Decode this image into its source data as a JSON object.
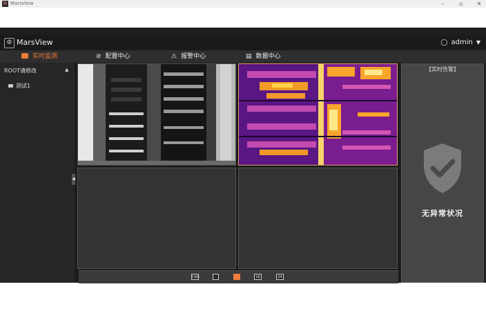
{
  "window": {
    "title": "MarsView",
    "logo_letter": "N",
    "controls": {
      "minimize": "–",
      "maximize": "▫",
      "close": "✕"
    }
  },
  "header": {
    "brand": "MarsView",
    "user": "admin",
    "icons": {
      "brand": "gear-icon",
      "user": "person-icon",
      "caret": "caret-down-icon"
    }
  },
  "nav": {
    "tabs": [
      {
        "label": "实时监测",
        "icon": "monitor-icon",
        "active": true
      },
      {
        "label": "配置中心",
        "icon": "settings-icon",
        "active": false
      },
      {
        "label": "报警中心",
        "icon": "alarm-icon",
        "active": false
      },
      {
        "label": "数据中心",
        "icon": "chart-icon",
        "active": false
      }
    ]
  },
  "sidebar": {
    "root_label": "ROOT请修改",
    "items": [
      {
        "label": "测试1",
        "icon": "camera-icon"
      }
    ]
  },
  "layout_buttons": [
    {
      "label": "CAD"
    },
    {
      "label": ""
    },
    {
      "label": ""
    },
    {
      "label": "16"
    },
    {
      "label": "24"
    }
  ],
  "alarm_panel": {
    "title": "【实时告警】",
    "status": "无异常状况",
    "icon": "shield-check-icon"
  },
  "colors": {
    "accent": "#f07d3a",
    "header_bg": "#1a1a1a",
    "nav_bg": "#2e2e2e",
    "panel_bg": "#464646"
  }
}
